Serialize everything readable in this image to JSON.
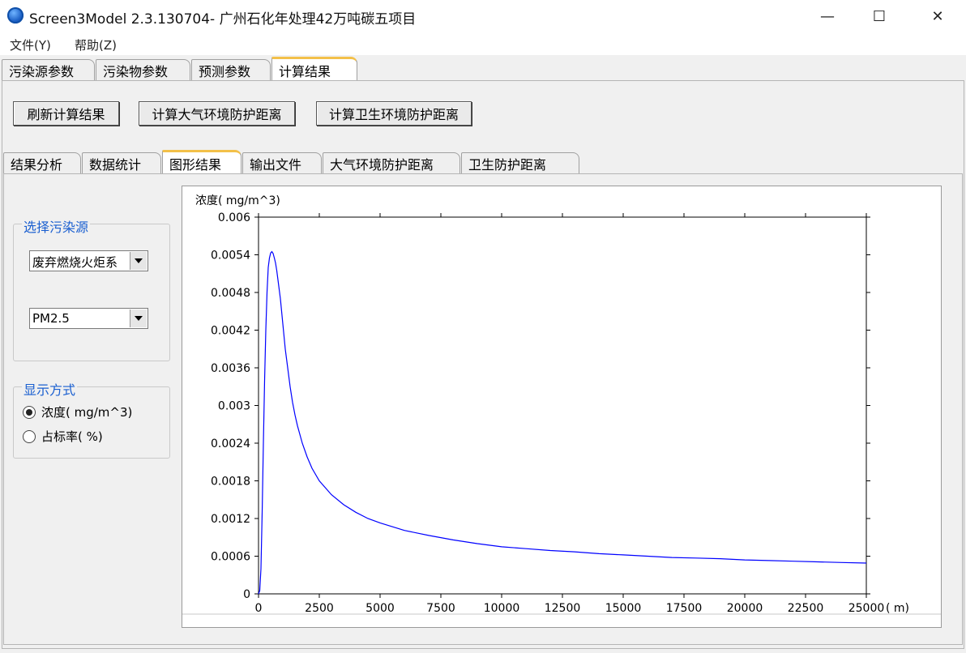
{
  "window": {
    "title": "Screen3Model 2.3.130704- 广州石化年处理42万吨碳五项目",
    "minimize": "—",
    "maximize": "☐",
    "close": "✕"
  },
  "menu": {
    "file": "文件(Y)",
    "help": "帮助(Z)"
  },
  "main_tabs": [
    "污染源参数",
    "污染物参数",
    "预测参数",
    "计算结果"
  ],
  "buttons": {
    "refresh": "刷新计算结果",
    "calc_air": "计算大气环境防护距离",
    "calc_health": "计算卫生环境防护距离"
  },
  "sub_tabs": [
    "结果分析",
    "数据统计",
    "图形结果",
    "输出文件",
    "大气环境防护距离",
    "卫生防护距离"
  ],
  "source_group": {
    "title": "选择污染源",
    "source_value": "废弃燃烧火炬系",
    "pollutant_value": "PM2.5"
  },
  "display_group": {
    "title": "显示方式",
    "option_concentration": "浓度( mg/m^3)",
    "option_ratio": "占标率( %)",
    "selected": "concentration"
  },
  "chart_data": {
    "type": "line",
    "ylabel": "浓度( mg/m^3)",
    "xlabel": "( m)",
    "xlim": [
      0,
      25000
    ],
    "ylim": [
      0,
      0.006
    ],
    "x_ticks": [
      0,
      2500,
      5000,
      7500,
      10000,
      12500,
      15000,
      17500,
      20000,
      22500,
      25000
    ],
    "x_tick_labels": [
      "0",
      "2500",
      "5000",
      "7500",
      "10000",
      "12500",
      "15000",
      "17500",
      "20000",
      "22500",
      "25000"
    ],
    "y_ticks": [
      0,
      0.0006,
      0.0012,
      0.0018,
      0.0024,
      0.003,
      0.0036,
      0.0042,
      0.0048,
      0.0054,
      0.006
    ],
    "y_tick_labels": [
      "0",
      "0.0006",
      "0.0012",
      "0.0018",
      "0.0024",
      "0.003",
      "0.0036",
      "0.0042",
      "0.0048",
      "0.0054",
      "0.006"
    ],
    "line_color": "#0000ff",
    "series": [
      {
        "x": [
          0,
          50,
          100,
          150,
          200,
          250,
          300,
          350,
          400,
          450,
          500,
          550,
          600,
          650,
          700,
          750,
          800,
          900,
          1000,
          1100,
          1200,
          1300,
          1400,
          1500,
          1600,
          1800,
          2000,
          2200,
          2500,
          3000,
          3500,
          4000,
          4500,
          5000,
          5500,
          6000,
          7000,
          8000,
          9000,
          10000,
          11000,
          12000,
          13000,
          14000,
          15000,
          16000,
          17000,
          18000,
          19000,
          20000,
          21000,
          22000,
          23000,
          24000,
          25000
        ],
        "y": [
          0,
          5e-05,
          0.0004,
          0.0013,
          0.0024,
          0.0034,
          0.0042,
          0.0048,
          0.0052,
          0.00535,
          0.00543,
          0.00545,
          0.00542,
          0.00535,
          0.00527,
          0.00515,
          0.005,
          0.0047,
          0.0043,
          0.0039,
          0.0036,
          0.0033,
          0.00305,
          0.00285,
          0.00268,
          0.0024,
          0.00218,
          0.002,
          0.0018,
          0.00158,
          0.00142,
          0.0013,
          0.0012,
          0.00113,
          0.00107,
          0.00101,
          0.00093,
          0.00086,
          0.0008,
          0.00075,
          0.00072,
          0.00069,
          0.00067,
          0.00064,
          0.00062,
          0.0006,
          0.00058,
          0.00057,
          0.00056,
          0.00054,
          0.00053,
          0.00052,
          0.00051,
          0.0005,
          0.00049
        ]
      }
    ]
  }
}
